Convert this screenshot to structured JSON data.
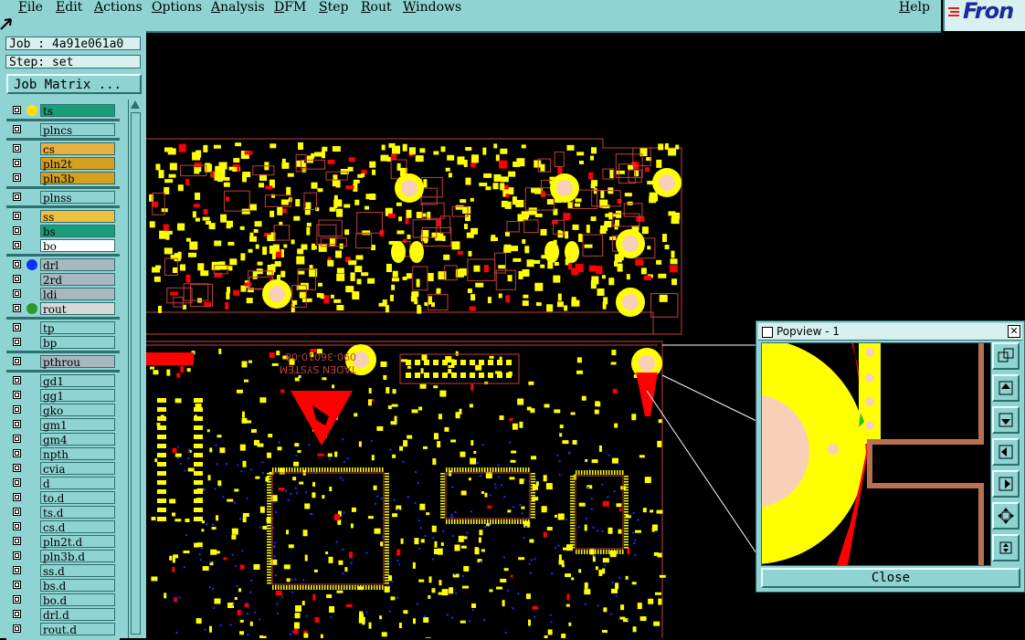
{
  "menubar": {
    "items": [
      "File",
      "Edit",
      "Actions",
      "Options",
      "Analysis",
      "DFM",
      "Step",
      "Rout",
      "Windows"
    ],
    "help": "Help"
  },
  "logo": {
    "text": "Fron"
  },
  "job": {
    "label": "Job : 4a91e061a0",
    "step": "Step: set",
    "matrix_button": "Job Matrix ..."
  },
  "layers": [
    {
      "name": "ts",
      "color": "#1a9e7a",
      "dot": "#ffe000"
    },
    {
      "name": "plncs",
      "color": "#8fd3d3",
      "dot": null
    },
    {
      "name": "cs",
      "color": "#e8b040",
      "dot": null
    },
    {
      "name": "pln2t",
      "color": "#d4a020",
      "dot": null
    },
    {
      "name": "pln3b",
      "color": "#d4a020",
      "dot": null
    },
    {
      "name": "plnss",
      "color": "#8fd3d3",
      "dot": null
    },
    {
      "name": "ss",
      "color": "#f0c040",
      "dot": null
    },
    {
      "name": "bs",
      "color": "#1a9e7a",
      "dot": null
    },
    {
      "name": "bo",
      "color": "#ffffff",
      "dot": null
    },
    {
      "name": "drl",
      "color": "#a8b8c0",
      "dot": "#1030ff"
    },
    {
      "name": "2rd",
      "color": "#a8b8c0",
      "dot": null
    },
    {
      "name": "ldi",
      "color": "#a8b8c0",
      "dot": null
    },
    {
      "name": "rout",
      "color": "#d8d8d8",
      "dot": "#2a9a2a"
    },
    {
      "name": "tp",
      "color": "#8fd3d3",
      "dot": null
    },
    {
      "name": "bp",
      "color": "#8fd3d3",
      "dot": null
    },
    {
      "name": "pthrou",
      "color": "#a8b8c0",
      "dot": null
    },
    {
      "name": "gd1",
      "color": "#8fd3d3",
      "dot": null
    },
    {
      "name": "gg1",
      "color": "#8fd3d3",
      "dot": null
    },
    {
      "name": "gko",
      "color": "#8fd3d3",
      "dot": null
    },
    {
      "name": "gm1",
      "color": "#8fd3d3",
      "dot": null
    },
    {
      "name": "gm4",
      "color": "#8fd3d3",
      "dot": null
    },
    {
      "name": "npth",
      "color": "#8fd3d3",
      "dot": null
    },
    {
      "name": "cvia",
      "color": "#8fd3d3",
      "dot": null
    },
    {
      "name": "d",
      "color": "#8fd3d3",
      "dot": null
    },
    {
      "name": "to.d",
      "color": "#8fd3d3",
      "dot": null
    },
    {
      "name": "ts.d",
      "color": "#8fd3d3",
      "dot": null
    },
    {
      "name": "cs.d",
      "color": "#8fd3d3",
      "dot": null
    },
    {
      "name": "pln2t.d",
      "color": "#8fd3d3",
      "dot": null
    },
    {
      "name": "pln3b.d",
      "color": "#8fd3d3",
      "dot": null
    },
    {
      "name": "ss.d",
      "color": "#8fd3d3",
      "dot": null
    },
    {
      "name": "bs.d",
      "color": "#8fd3d3",
      "dot": null
    },
    {
      "name": "bo.d",
      "color": "#8fd3d3",
      "dot": null
    },
    {
      "name": "drl.d",
      "color": "#8fd3d3",
      "dot": null
    },
    {
      "name": "rout.d",
      "color": "#8fd3d3",
      "dot": null
    }
  ],
  "board": {
    "silk_text_1": "TADEN SYSTEM",
    "silk_text_2": "090-36010-08"
  },
  "popview": {
    "title": "Popview - 1",
    "close_label": "Close"
  },
  "colors": {
    "panel": "#8fd3d3",
    "pad": "#ffff00",
    "copper": "#ff0000",
    "outline": "#c04040",
    "drill": "#1030ff",
    "rout": "#b87050"
  }
}
